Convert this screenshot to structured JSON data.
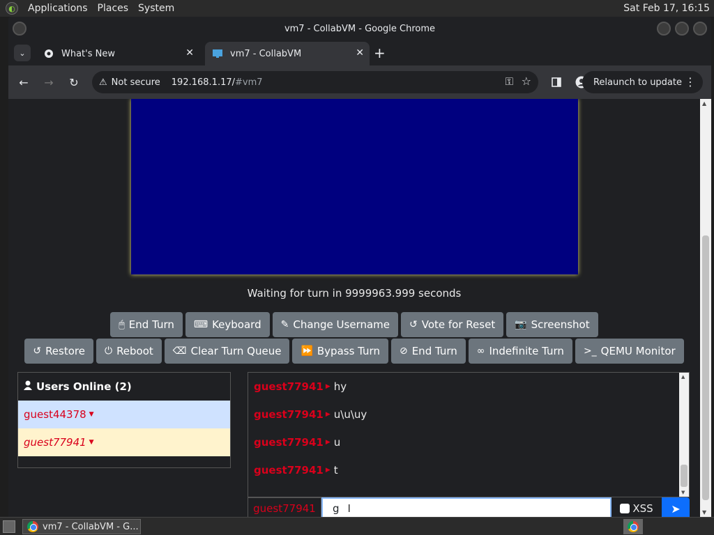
{
  "os_panel": {
    "menus": [
      "Applications",
      "Places",
      "System"
    ],
    "clock": "Sat Feb 17, 16:15"
  },
  "window": {
    "title": "vm7 - CollabVM - Google Chrome"
  },
  "tabs": [
    {
      "label": "What's New",
      "close": "✕"
    },
    {
      "label": "vm7 - CollabVM",
      "close": "✕"
    }
  ],
  "tabbar": {
    "dropdown": "⌄",
    "new_tab": "+"
  },
  "toolbar": {
    "back": "←",
    "forward": "→",
    "reload": "↻",
    "security": "Not secure",
    "url_host": "192.168.1.17/",
    "url_path": "#vm7",
    "key_icon": "⚿",
    "star_icon": "☆",
    "relaunch": "Relaunch to update",
    "menu_dots": "⋮"
  },
  "vm": {
    "screen_color": "#00007f",
    "waiting_text": "Waiting for turn in 9999963.999 seconds"
  },
  "buttons_row1": [
    {
      "icon": "🖱",
      "label": "End Turn"
    },
    {
      "icon": "⌨",
      "label": "Keyboard"
    },
    {
      "icon": "✎",
      "label": "Change Username"
    },
    {
      "icon": "↺",
      "label": "Vote for Reset"
    },
    {
      "icon": "📷",
      "label": "Screenshot"
    }
  ],
  "buttons_row2": [
    {
      "icon": "↺",
      "label": "Restore"
    },
    {
      "icon": "⏻",
      "label": "Reboot"
    },
    {
      "icon": "⌫",
      "label": "Clear Turn Queue"
    },
    {
      "icon": "⏩",
      "label": "Bypass Turn"
    },
    {
      "icon": "⊘",
      "label": "End Turn"
    },
    {
      "icon": "∞",
      "label": "Indefinite Turn"
    },
    {
      "icon": ">_",
      "label": "QEMU Monitor"
    }
  ],
  "users": {
    "header": "Users Online (2)",
    "list": [
      "guest44378",
      "guest77941"
    ],
    "caret": "▼"
  },
  "chat": {
    "separator": "▶",
    "messages": [
      {
        "name": "guest77941",
        "text": "hy"
      },
      {
        "name": "guest77941",
        "text": "u\\u\\uy"
      },
      {
        "name": "guest77941",
        "text": "u"
      },
      {
        "name": "guest77941",
        "text": "t"
      }
    ],
    "input_username": "guest77941",
    "input_value": "g",
    "xss_label": "XSS",
    "send_icon": "➤"
  },
  "taskbar": {
    "task_label": "vm7 - CollabVM - G..."
  },
  "colors": {
    "accent": "#0d6efd",
    "username": "#d9001b",
    "button": "#6c757d"
  }
}
